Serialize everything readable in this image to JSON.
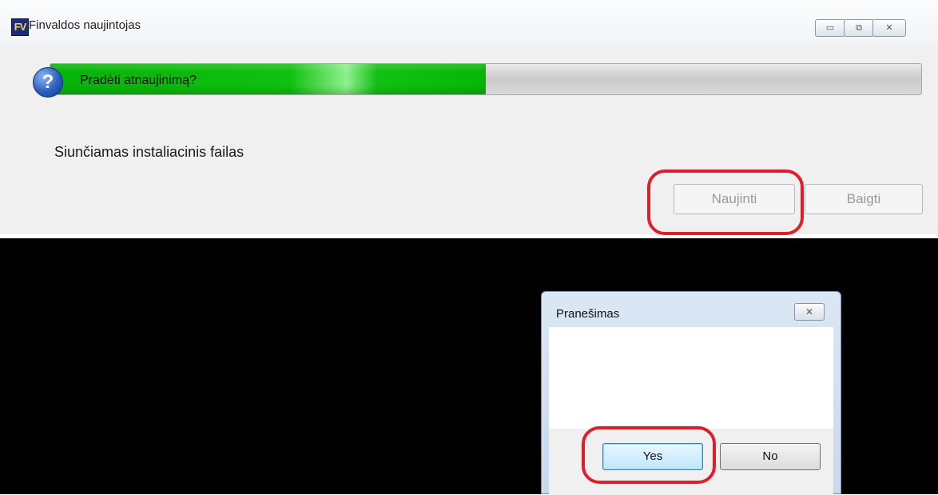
{
  "main_window": {
    "title": "Finvaldos naujintojas",
    "icon": "finvalda-app-icon",
    "controls": {
      "minimize": "▭",
      "maximize": "⧉",
      "close": "✕"
    },
    "progress": {
      "value_percent": 50
    },
    "status_text": "Siunčiamas instaliacinis failas",
    "buttons": {
      "update": "Naujinti",
      "finish": "Baigti"
    }
  },
  "dialog": {
    "title": "Pranešimas",
    "close": "✕",
    "icon": "question-icon",
    "icon_glyph": "?",
    "message": "Pradėti atnaujinimą?",
    "buttons": {
      "yes": "Yes",
      "no": "No"
    }
  },
  "colors": {
    "progress": "#10c010",
    "highlight": "#de1f2a",
    "desktop": "#000000"
  }
}
